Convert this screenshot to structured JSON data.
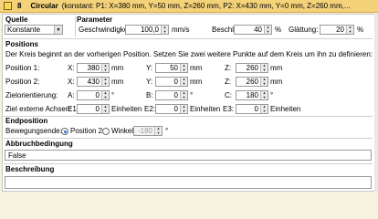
{
  "title": {
    "number": "8",
    "name": "Circular",
    "description": "(konstant: P1: X=380 mm, Y=50 mm, Z=260 mm, P2: X=430 mm, Y=0 mm, Z=260 mm,..."
  },
  "quelle": {
    "header": "Quelle",
    "selected": "Konstante"
  },
  "parameter": {
    "header": "Parameter",
    "speed_label": "Geschwindigkeit:",
    "speed_value": "100,0",
    "speed_unit": "mm/s",
    "accel_label": "Beschleunigung:",
    "accel_value": "40",
    "accel_unit": "%",
    "smooth_label": "Glättung:",
    "smooth_value": "20",
    "smooth_unit": "%"
  },
  "positions": {
    "header": "Positions",
    "info": "Der Kreis beginnt an der vorherigen Position. Setzen Sie zwei weitere Punkte auf dem Kreis um ihn zu definieren:",
    "rows": [
      {
        "label": "Position 1:",
        "a_label": "X:",
        "a_value": "380",
        "a_unit": "mm",
        "b_label": "Y:",
        "b_value": "50",
        "b_unit": "mm",
        "c_label": "Z:",
        "c_value": "260",
        "c_unit": "mm"
      },
      {
        "label": "Position 2:",
        "a_label": "X:",
        "a_value": "430",
        "a_unit": "mm",
        "b_label": "Y:",
        "b_value": "0",
        "b_unit": "mm",
        "c_label": "Z:",
        "c_value": "260",
        "c_unit": "mm"
      },
      {
        "label": "Zielorientierung:",
        "a_label": "A:",
        "a_value": "0",
        "a_unit": "°",
        "b_label": "B:",
        "b_value": "0",
        "b_unit": "°",
        "c_label": "C:",
        "c_value": "180",
        "c_unit": "°"
      },
      {
        "label": "Ziel externe Achsen:",
        "a_label": "E1:",
        "a_value": "0",
        "a_unit": "Einheiten",
        "b_label": "E2:",
        "b_value": "0",
        "b_unit": "Einheiten",
        "c_label": "E3:",
        "c_value": "0",
        "c_unit": "Einheiten"
      }
    ]
  },
  "endposition": {
    "header": "Endposition",
    "label": "Bewegungsende:",
    "option1": "Position 2",
    "option2": "Winkel:",
    "angle_value": "-180",
    "angle_unit": "°"
  },
  "abbruch": {
    "header": "Abbruchbedingung",
    "value": "False"
  },
  "beschreibung": {
    "header": "Beschreibung",
    "value": ""
  }
}
